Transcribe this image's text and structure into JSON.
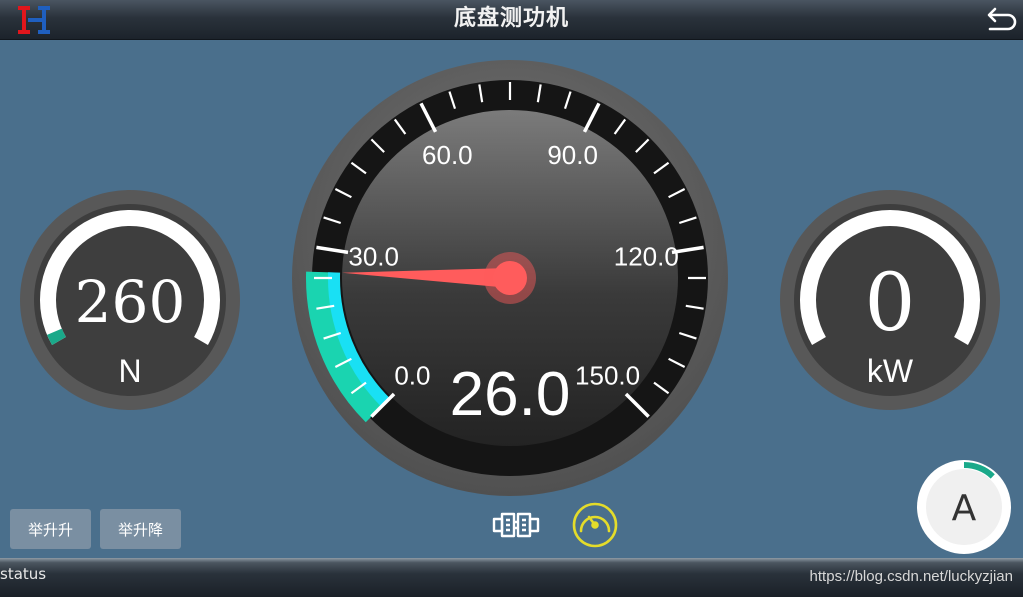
{
  "header": {
    "title": "底盘测功机",
    "logo_icon": "hx-logo-icon",
    "back_icon": "undo-arrow-icon"
  },
  "left_gauge": {
    "value": "260",
    "unit": "N",
    "fill_fraction": 0.03,
    "accent_color": "#1aa98a"
  },
  "main_gauge": {
    "value": "26.0",
    "min": 0,
    "max": 150,
    "ticks": [
      "0.0",
      "30.0",
      "60.0",
      "90.0",
      "120.0",
      "150.0"
    ],
    "needle_value": 26.0,
    "progress_colors": [
      "#1ad4b0",
      "#19e0f4"
    ],
    "needle_color": "#ff5c5c"
  },
  "right_gauge": {
    "value": "0",
    "unit": "kW",
    "fill_fraction": 0.0
  },
  "mode_badge": {
    "label": "A",
    "progress_fraction": 0.12,
    "accent_color": "#1aa98a"
  },
  "buttons": {
    "lift_up": "举升升",
    "lift_down": "举升降"
  },
  "icons": {
    "coupling": "roller-coupling-icon",
    "speedometer": "speedometer-icon",
    "speedometer_color": "#e4dc2a"
  },
  "status_bar": {
    "status_text": "status",
    "watermark": "https://blog.csdn.net/luckyzjian"
  }
}
